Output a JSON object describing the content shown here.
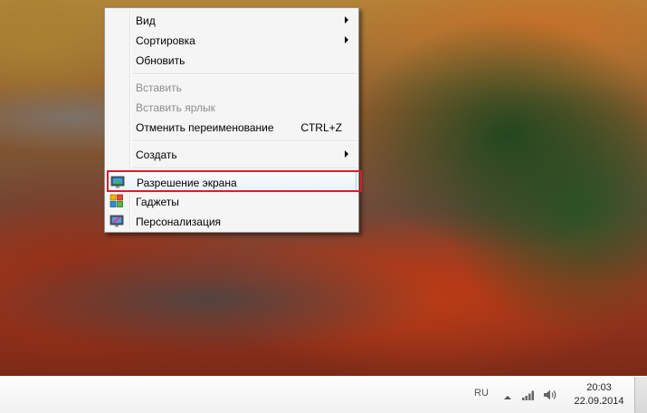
{
  "context_menu": {
    "items": [
      {
        "label": "Вид",
        "submenu": true
      },
      {
        "label": "Сортировка",
        "submenu": true
      },
      {
        "label": "Обновить"
      },
      {
        "label": "Вставить",
        "disabled": true
      },
      {
        "label": "Вставить ярлык",
        "disabled": true
      },
      {
        "label": "Отменить переименование",
        "shortcut": "CTRL+Z"
      },
      {
        "label": "Создать",
        "submenu": true
      },
      {
        "label": "Разрешение экрана",
        "icon": "screen-resolution-icon",
        "highlighted": true
      },
      {
        "label": "Гаджеты",
        "icon": "gadgets-icon"
      },
      {
        "label": "Персонализация",
        "icon": "personalization-icon"
      }
    ]
  },
  "taskbar": {
    "language": "RU",
    "tray_icons": [
      "show-hidden-icons-icon",
      "network-signal-icon",
      "volume-icon"
    ],
    "clock": {
      "time": "20:03",
      "date": "22.09.2014"
    }
  },
  "colors": {
    "highlight_frame": "#d6202a",
    "menu_bg": "#f5f5f5"
  }
}
